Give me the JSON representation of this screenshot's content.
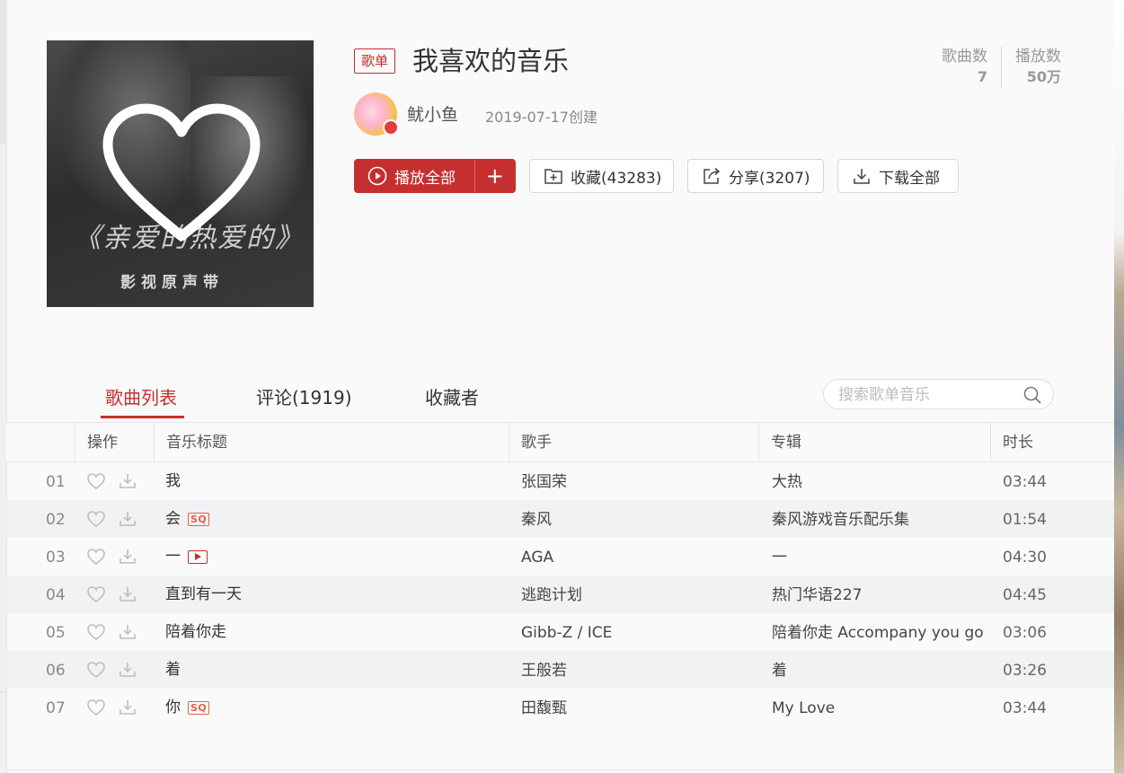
{
  "playlist": {
    "tag": "歌单",
    "title": "我喜欢的音乐",
    "creator": "鱿小鱼",
    "created": "2019-07-17创建",
    "cover": {
      "title_art": "《亲爱的热爱的》",
      "sub_art": "影视原声带"
    }
  },
  "stats": [
    {
      "label": "歌曲数",
      "value": "7"
    },
    {
      "label": "播放数",
      "value": "50万"
    }
  ],
  "actions": {
    "play_all": "播放全部",
    "add": "+",
    "favorite": "收藏(43283)",
    "share": "分享(3207)",
    "download_all": "下载全部"
  },
  "tabs": [
    {
      "label": "歌曲列表",
      "active": true
    },
    {
      "label": "评论(1919)",
      "active": false
    },
    {
      "label": "收藏者",
      "active": false
    }
  ],
  "search": {
    "placeholder": "搜索歌单音乐"
  },
  "table": {
    "headers": [
      "操作",
      "音乐标题",
      "歌手",
      "专辑",
      "时长"
    ],
    "rows": [
      {
        "num": "01",
        "title": "我",
        "badge": "",
        "artist": "张国荣",
        "album": "大热",
        "duration": "03:44"
      },
      {
        "num": "02",
        "title": "会",
        "badge": "SQ",
        "artist": "秦风",
        "album": "秦风游戏音乐配乐集",
        "duration": "01:54"
      },
      {
        "num": "03",
        "title": "一",
        "badge": "MV",
        "artist": "AGA",
        "album": "一",
        "duration": "04:30"
      },
      {
        "num": "04",
        "title": "直到有一天",
        "badge": "",
        "artist": "逃跑计划",
        "album": "热门华语227",
        "duration": "04:45"
      },
      {
        "num": "05",
        "title": "陪着你走",
        "badge": "",
        "artist": "Gibb-Z / ICE",
        "album": "陪着你走 Accompany you go",
        "duration": "03:06"
      },
      {
        "num": "06",
        "title": "着",
        "badge": "",
        "artist": "王般若",
        "album": "着",
        "duration": "03:26"
      },
      {
        "num": "07",
        "title": "你",
        "badge": "SQ",
        "artist": "田馥甄",
        "album": "My Love",
        "duration": "03:44"
      }
    ]
  },
  "colors": {
    "accent": "#c62f2f",
    "sq_badge": "#e7604a",
    "row_alt": "#f2f2f4"
  }
}
